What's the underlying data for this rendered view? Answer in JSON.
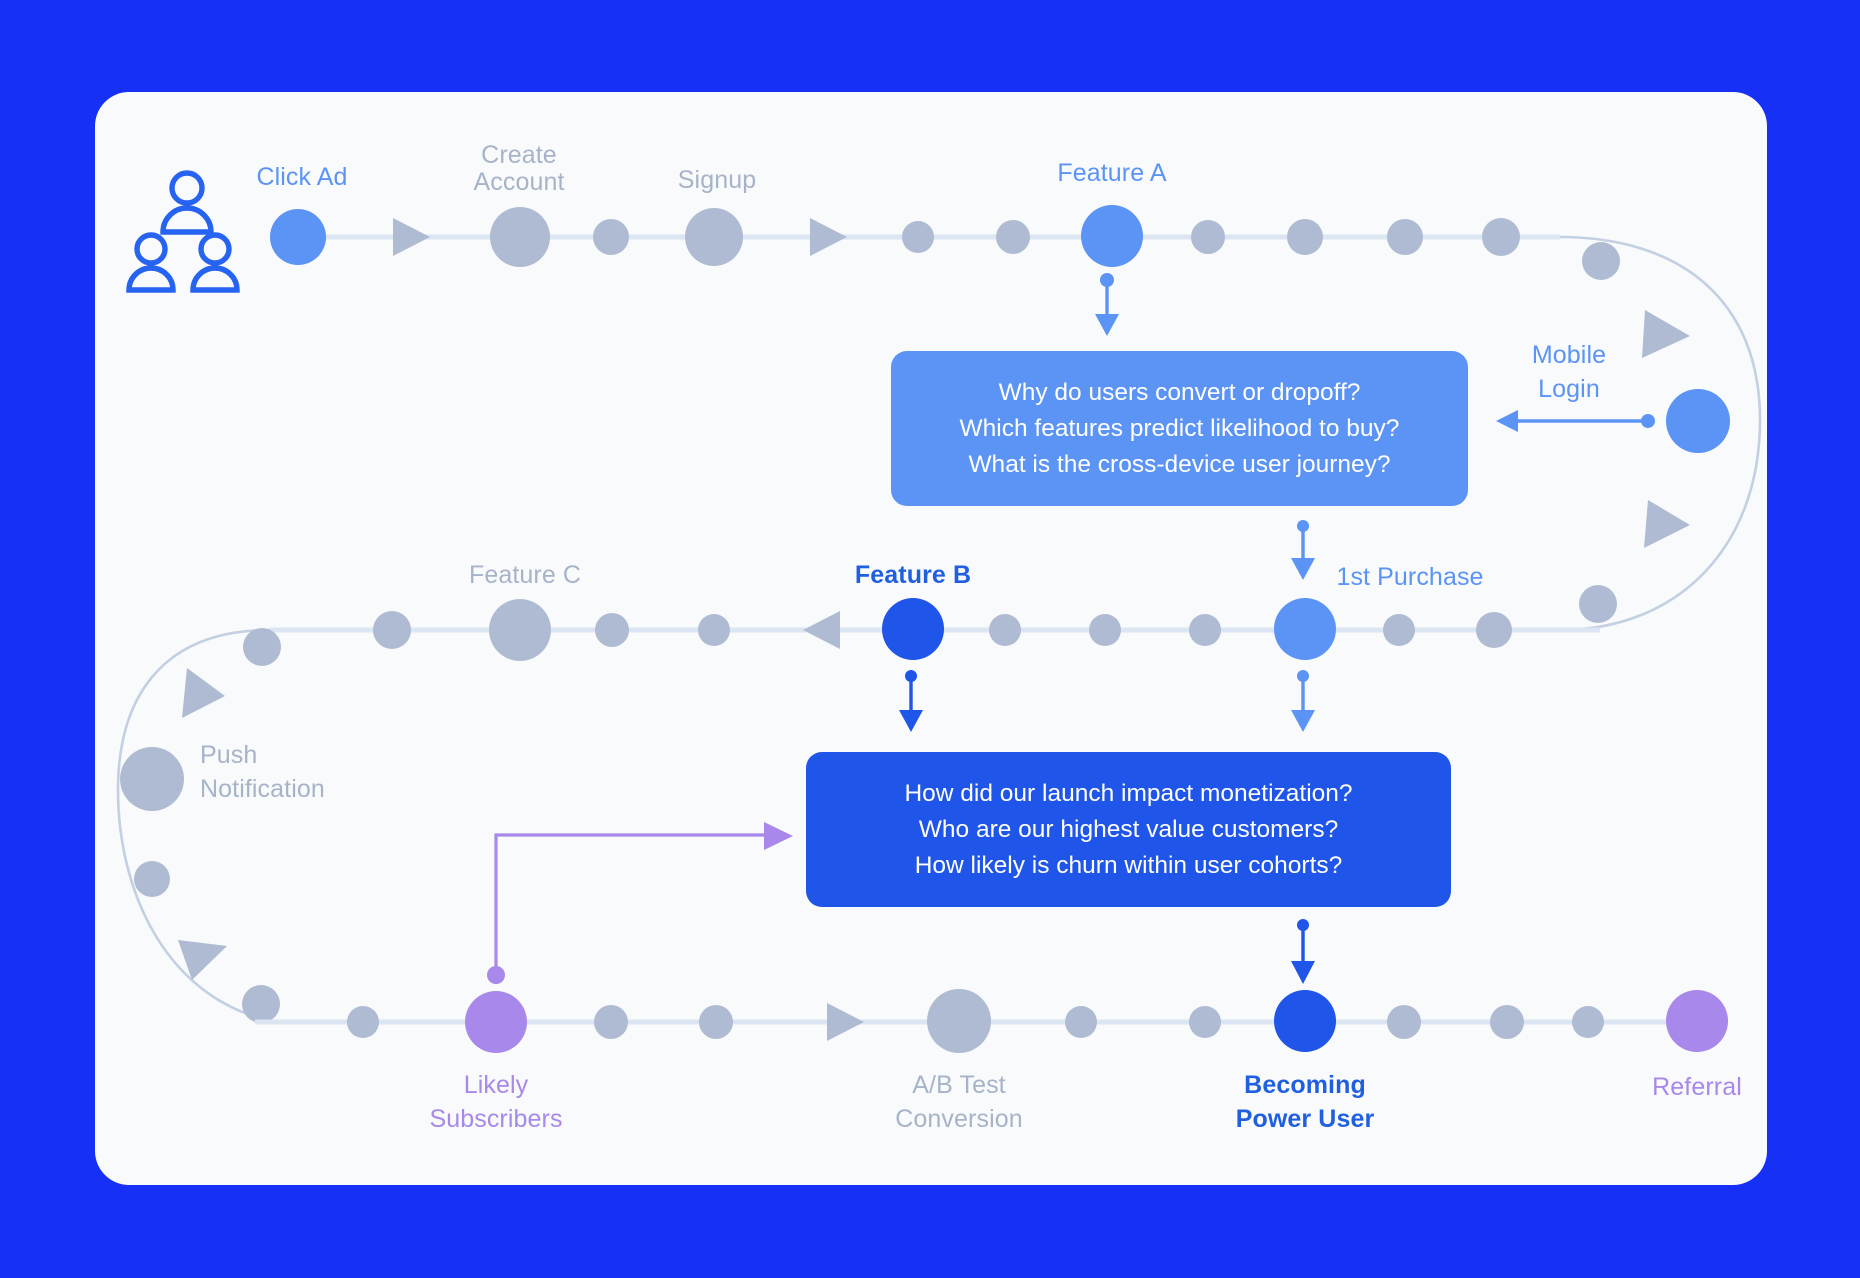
{
  "canvas": {
    "background_color": "#1630F5",
    "card_color": "#F9FAFB"
  },
  "colors": {
    "node_grey": "#AEBBD2",
    "node_light_blue": "#5B94F5",
    "node_strong_blue": "#1F55E8",
    "node_purple": "#A888EA",
    "track": "#DCE5F2",
    "label_grey": "#A7B3C9",
    "label_blue": "#5B94F5",
    "label_dark_blue": "#1F5FE0",
    "label_purple": "#A888EA",
    "box_light": "#5B94F5",
    "box_dark": "#1F55E8",
    "brand_blue": "#1630F5"
  },
  "icons": {
    "users_group": "users-group-icon"
  },
  "journey": {
    "title": "User journey flow",
    "labels": [
      {
        "id": "click-ad",
        "text": "Click Ad",
        "style": "blue"
      },
      {
        "id": "create-account",
        "text": "Create\nAccount",
        "style": "grey"
      },
      {
        "id": "signup",
        "text": "Signup",
        "style": "grey"
      },
      {
        "id": "feature-a",
        "text": "Feature A",
        "style": "blue"
      },
      {
        "id": "mobile-login",
        "text": "Mobile\nLogin",
        "style": "blue"
      },
      {
        "id": "first-purchase",
        "text": "1st Purchase",
        "style": "blue"
      },
      {
        "id": "feature-b",
        "text": "Feature B",
        "style": "dark-blue"
      },
      {
        "id": "feature-c",
        "text": "Feature C",
        "style": "grey"
      },
      {
        "id": "push-notification",
        "text": "Push\nNotification",
        "style": "grey"
      },
      {
        "id": "likely-subscribers",
        "text": "Likely\nSubscribers",
        "style": "purple"
      },
      {
        "id": "ab-test-conversion",
        "text": "A/B Test\nConversion",
        "style": "grey"
      },
      {
        "id": "becoming-power-user",
        "text": "Becoming\nPower User",
        "style": "dark-blue"
      },
      {
        "id": "referral",
        "text": "Referral",
        "style": "purple"
      }
    ]
  },
  "labels": {
    "click_ad": "Click Ad",
    "create_account_l1": "Create",
    "create_account_l2": "Account",
    "signup": "Signup",
    "feature_a": "Feature A",
    "mobile_login_l1": "Mobile",
    "mobile_login_l2": "Login",
    "first_purchase": "1st Purchase",
    "feature_b": "Feature B",
    "feature_c": "Feature C",
    "push_notification_l1": "Push",
    "push_notification_l2": "Notification",
    "likely_subscribers_l1": "Likely",
    "likely_subscribers_l2": "Subscribers",
    "ab_test_l1": "A/B Test",
    "ab_test_l2": "Conversion",
    "power_user_l1": "Becoming",
    "power_user_l2": "Power User",
    "referral": "Referral"
  },
  "question_box_1": {
    "id": "behavioral-questions",
    "line1": "Why do users convert or dropoff?",
    "line2": "Which features predict likelihood to buy?",
    "line3": "What is the cross-device user journey?"
  },
  "question_box_2": {
    "id": "monetization-questions",
    "line1": "How did our launch impact monetization?",
    "line2": "Who are our highest value customers?",
    "line3": "How likely is churn within user cohorts?"
  }
}
